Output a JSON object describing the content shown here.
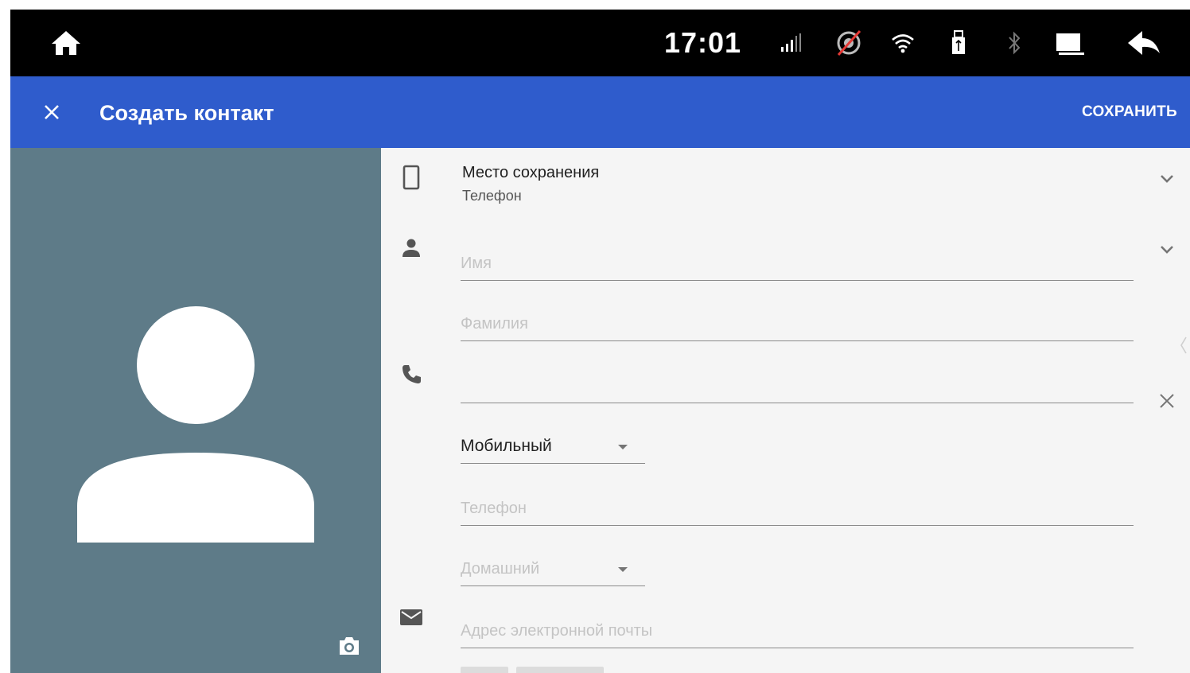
{
  "status_bar": {
    "time": "17:01",
    "icons": [
      "home-icon",
      "signal-icon",
      "gps-off-icon",
      "wifi-icon",
      "usb-icon",
      "bluetooth-icon",
      "screen-icon",
      "back-icon"
    ]
  },
  "app_bar": {
    "close_icon": "close-icon",
    "title": "Создать контакт",
    "save_label": "СОХРАНИТЬ",
    "color": "#2f5ccc"
  },
  "photo": {
    "background": "#5e7b88",
    "camera_icon": "camera-icon"
  },
  "form": {
    "storage": {
      "label": "Место сохранения",
      "value": "Телефон"
    },
    "first_name": {
      "placeholder": "Имя"
    },
    "last_name": {
      "placeholder": "Фамилия"
    },
    "phone1": {
      "value": "",
      "type": "Мобильный"
    },
    "phone2": {
      "placeholder": "Телефон",
      "type": "Домашний"
    },
    "email": {
      "placeholder": "Адрес электронной почты"
    }
  }
}
